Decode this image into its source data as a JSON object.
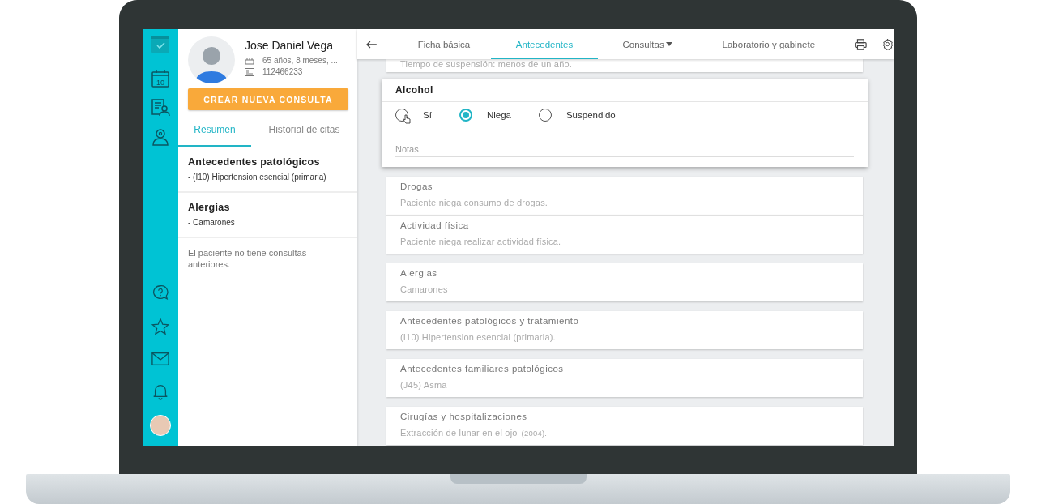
{
  "nav": {
    "calendar_day": "10"
  },
  "patient": {
    "name": "Jose Daniel Vega",
    "age": "65 años, 8 meses, ...",
    "id_number": "112466233",
    "action_button": "CREAR NUEVA CONSULTA"
  },
  "panel_tabs": [
    {
      "label": "Resumen",
      "selected": true
    },
    {
      "label": "Historial de citas",
      "selected": false
    }
  ],
  "summary": [
    {
      "title": "Antecedentes patológicos",
      "items": [
        "- (I10) Hipertension esencial (primaria)"
      ]
    },
    {
      "title": "Alergias",
      "items": [
        "- Camarones"
      ]
    }
  ],
  "summary_note": "El paciente no tiene consultas anteriores.",
  "tabs": [
    {
      "label": "Ficha básica",
      "selected": false,
      "dropdown": false
    },
    {
      "label": "Antecedentes",
      "selected": true,
      "dropdown": false
    },
    {
      "label": "Consultas",
      "selected": false,
      "dropdown": true
    },
    {
      "label": "Laboratorio y gabinete",
      "selected": false,
      "dropdown": false
    }
  ],
  "partial_card_text": "Tiempo de suspensión: menos de un año.",
  "alcohol": {
    "title": "Alcohol",
    "options": [
      {
        "label": "Sí",
        "selected": false
      },
      {
        "label": "Niega",
        "selected": true
      },
      {
        "label": "Suspendido",
        "selected": false
      }
    ],
    "notes": {
      "placeholder": "Notas"
    }
  },
  "card_groups": [
    {
      "cards": [
        {
          "title": "Drogas",
          "text": "Paciente niega consumo de drogas."
        },
        {
          "title": "Actividad física",
          "text": "Paciente niega realizar actividad física."
        }
      ]
    },
    {
      "cards": [
        {
          "title": "Alergias",
          "text": "Camarones"
        }
      ]
    },
    {
      "cards": [
        {
          "title": "Antecedentes patológicos y tratamiento",
          "text": "(I10) Hipertension esencial (primaria)."
        }
      ]
    },
    {
      "cards": [
        {
          "title": "Antecedentes familiares patológicos",
          "text": "(J45) Asma"
        }
      ]
    },
    {
      "cards": [
        {
          "title": "Cirugías y hospitalizaciones",
          "text": "Extracción de lunar en el ojo",
          "date": "(2004)."
        }
      ]
    }
  ]
}
